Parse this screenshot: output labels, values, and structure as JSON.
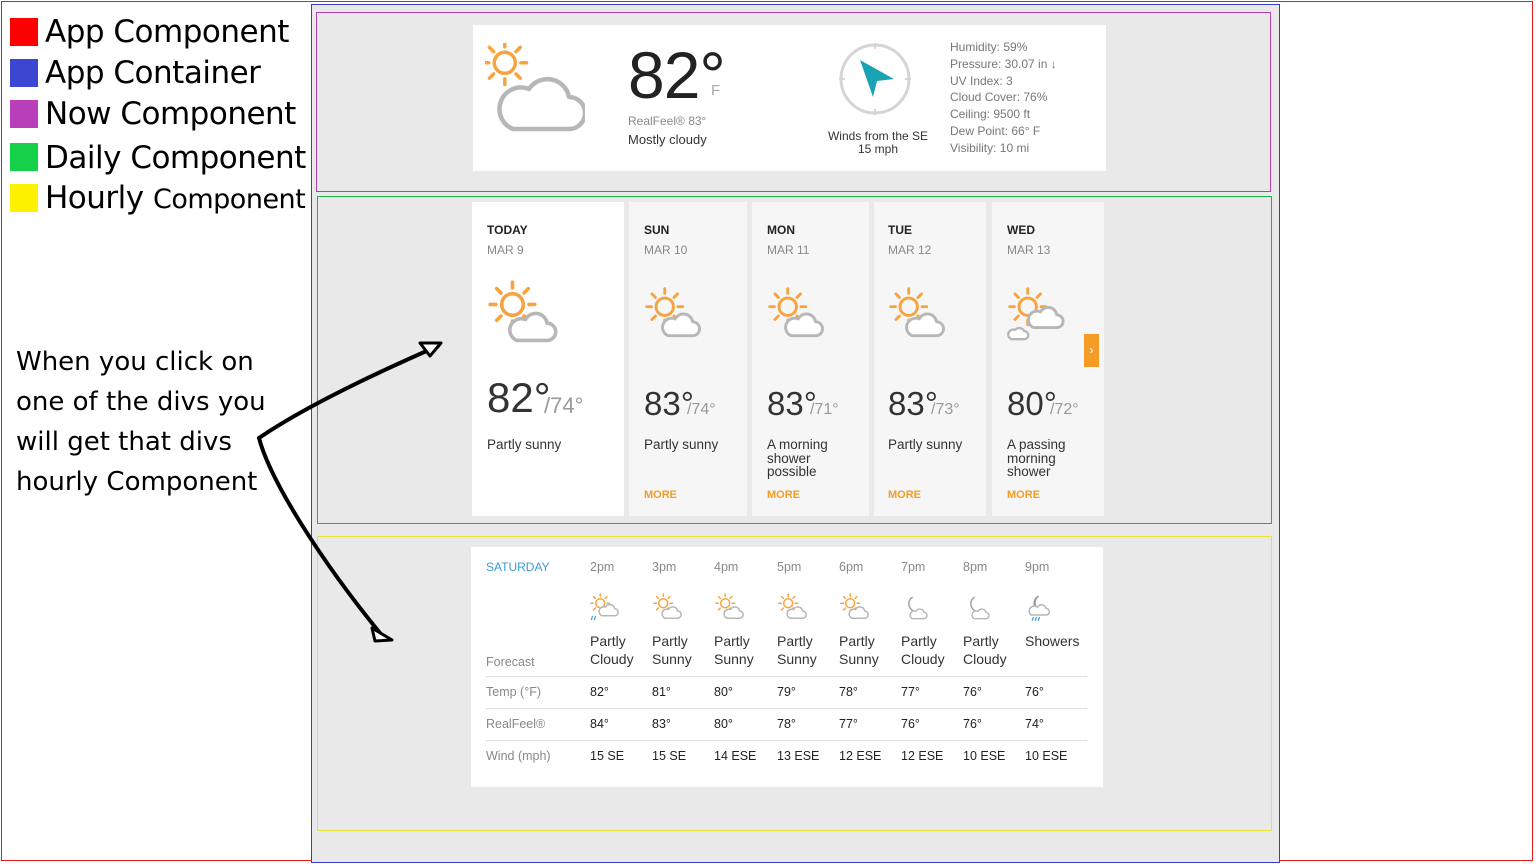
{
  "legend": [
    {
      "label": "App Component",
      "label_main": "",
      "label_small": "",
      "color": "#ff0000"
    },
    {
      "label": "App Container",
      "label_main": "",
      "label_small": "",
      "color": "#3b46d1"
    },
    {
      "label": "Now Component",
      "label_main": "",
      "label_small": "",
      "color": "#b93fba"
    },
    {
      "label": "",
      "label_main": "Daily",
      "label_small": "Component",
      "color": "#14d149"
    },
    {
      "label": "",
      "label_main": "Hourly",
      "label_small": "Component",
      "color": "#fff200"
    }
  ],
  "note": [
    "When you click on",
    "one of the divs you",
    "will get that divs",
    "hourly Component"
  ],
  "now": {
    "icon": "partly-cloudy-icon",
    "temp": "82°",
    "unit": "F",
    "realfeel": "RealFeel® 83°",
    "phrase": "Mostly cloudy",
    "wind_direction": "Winds from the SE",
    "wind_speed": "15 mph",
    "details": [
      "Humidity: 59%",
      "Pressure: 30.07 in ↓",
      "UV Index: 3",
      "Cloud Cover: 76%",
      "Ceiling: 9500 ft",
      "Dew Point: 66° F",
      "Visibility: 10 mi"
    ]
  },
  "daily": {
    "next_label": "›",
    "days": [
      {
        "name": "TODAY",
        "date": "MAR 9",
        "hi": "82°",
        "lo": "/74°",
        "phrase": [
          "Partly sunny"
        ],
        "more": "",
        "icon": "partly-sunny-icon"
      },
      {
        "name": "SUN",
        "date": "MAR 10",
        "hi": "83°",
        "lo": "/74°",
        "phrase": [
          "Partly sunny"
        ],
        "more": "MORE",
        "icon": "partly-sunny-icon"
      },
      {
        "name": "MON",
        "date": "MAR 11",
        "hi": "83°",
        "lo": "/71°",
        "phrase": [
          "A morning",
          "shower",
          "possible"
        ],
        "more": "MORE",
        "icon": "partly-sunny-icon"
      },
      {
        "name": "TUE",
        "date": "MAR 12",
        "hi": "83°",
        "lo": "/73°",
        "phrase": [
          "Partly sunny"
        ],
        "more": "MORE",
        "icon": "partly-sunny-icon"
      },
      {
        "name": "WED",
        "date": "MAR 13",
        "hi": "80°",
        "lo": "/72°",
        "phrase": [
          "A passing",
          "morning",
          "shower"
        ],
        "more": "MORE",
        "icon": "sun-cloud-shower-icon"
      }
    ]
  },
  "hourly": {
    "day": "SATURDAY",
    "forecast_label": "Forecast",
    "rows": [
      {
        "label": "Temp (°F)",
        "values": [
          "82°",
          "81°",
          "80°",
          "79°",
          "78°",
          "77°",
          "76°",
          "76°"
        ]
      },
      {
        "label": "RealFeel®",
        "values": [
          "84°",
          "83°",
          "80°",
          "78°",
          "77°",
          "76°",
          "76°",
          "74°"
        ]
      },
      {
        "label": "Wind (mph)",
        "values": [
          "15 SE",
          "15 SE",
          "14 ESE",
          "13 ESE",
          "12 ESE",
          "12 ESE",
          "10 ESE",
          "10 ESE"
        ]
      }
    ],
    "hours": [
      {
        "time": "2pm",
        "phrase": [
          "Partly",
          "Cloudy"
        ],
        "icon": "partly-cloudy-rain-icon"
      },
      {
        "time": "3pm",
        "phrase": [
          "Partly",
          "Sunny"
        ],
        "icon": "partly-sunny-icon"
      },
      {
        "time": "4pm",
        "phrase": [
          "Partly",
          "Sunny"
        ],
        "icon": "partly-sunny-icon"
      },
      {
        "time": "5pm",
        "phrase": [
          "Partly",
          "Sunny"
        ],
        "icon": "partly-sunny-icon"
      },
      {
        "time": "6pm",
        "phrase": [
          "Partly",
          "Sunny"
        ],
        "icon": "partly-sunny-icon"
      },
      {
        "time": "7pm",
        "phrase": [
          "Partly",
          "Cloudy"
        ],
        "icon": "moon-cloud-icon"
      },
      {
        "time": "8pm",
        "phrase": [
          "Partly",
          "Cloudy"
        ],
        "icon": "moon-cloud-icon"
      },
      {
        "time": "9pm",
        "phrase": [
          "Showers",
          ""
        ],
        "icon": "moon-cloud-rain-icon"
      }
    ]
  },
  "colors": {
    "app_component": "#ff0000",
    "app_container": "#3b46d1",
    "now_component": "#b93fba",
    "daily_component": "#14d149",
    "hourly_component": "#fff200",
    "accent_orange": "#f59c27",
    "accent_blue": "#3d9bd8",
    "compass_arrow": "#1aa3b5"
  }
}
